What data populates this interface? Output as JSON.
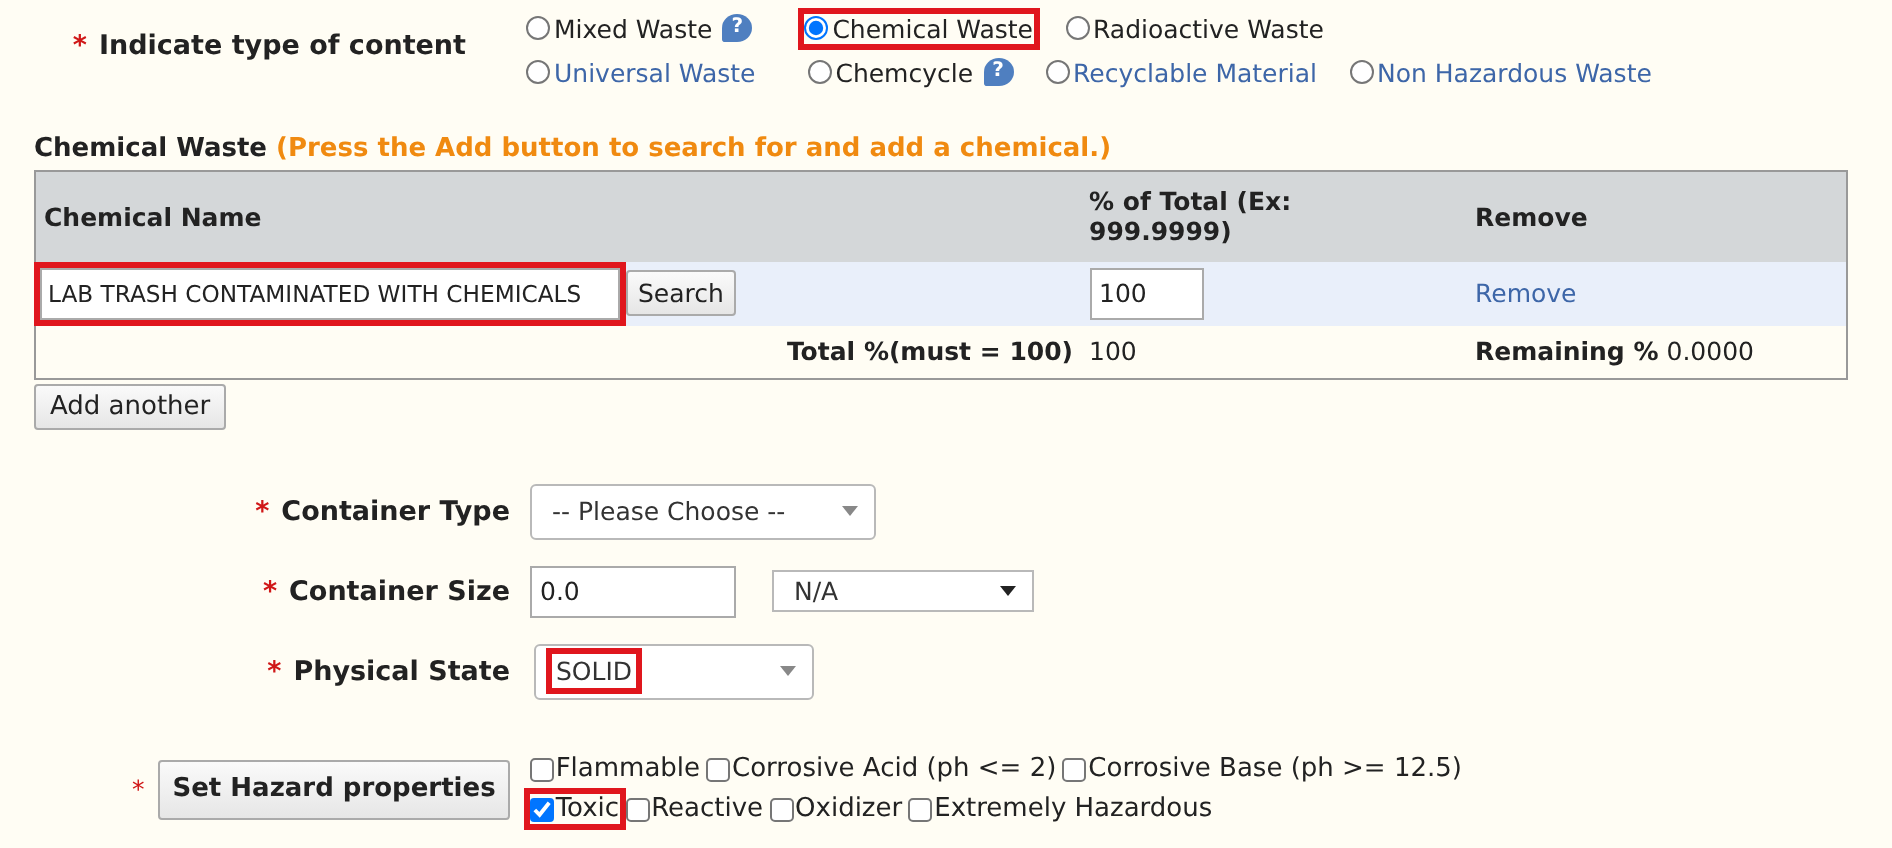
{
  "content_type": {
    "required_mark": "*",
    "label": "Indicate type of content",
    "option_rows": [
      {
        "options": [
          {
            "label": "Mixed Waste",
            "selected": false,
            "link": false,
            "highlighted": false,
            "help": "?"
          },
          {
            "label": "Chemical Waste",
            "selected": true,
            "link": false,
            "highlighted": true
          },
          {
            "label": "Radioactive Waste",
            "selected": false,
            "link": false,
            "highlighted": false
          }
        ]
      },
      {
        "options": [
          {
            "label": "Universal Waste",
            "selected": false,
            "link": true,
            "highlighted": false
          },
          {
            "label": "Chemcycle",
            "selected": false,
            "link": false,
            "highlighted": false,
            "help": "?"
          },
          {
            "label": "Recyclable Material",
            "selected": false,
            "link": true,
            "highlighted": false
          },
          {
            "label": "Non Hazardous Waste",
            "selected": false,
            "link": true,
            "highlighted": false
          }
        ]
      }
    ]
  },
  "chemical_section": {
    "title": "Chemical Waste",
    "hint": "(Press the Add button to search for and add a chemical.)",
    "columns": [
      "Chemical Name",
      "% of Total (Ex: 999.9999)",
      "Remove"
    ],
    "rows": [
      {
        "chemical_name": "LAB TRASH CONTAMINATED WITH CHEMICALS",
        "highlighted": true,
        "search_button": "Search",
        "percent": "100",
        "remove": "Remove"
      }
    ],
    "total": {
      "label": "Total %(must = 100)",
      "value": "100",
      "remaining": "**Remaining %** 0.0000"
    },
    "add_button": "Add another"
  },
  "container": {
    "fields": [
      {
        "kind": "select",
        "required_mark": "*",
        "label": "Container Type",
        "value": "-- Please Choose --",
        "highlighted": false
      },
      {
        "kind": "input_select",
        "required_mark": "*",
        "label": "Container Size",
        "value": "0.0",
        "unit": "N/A"
      },
      {
        "kind": "select",
        "required_mark": "*",
        "label": "Physical State",
        "value": "SOLID",
        "highlighted": true
      }
    ]
  },
  "hazard": {
    "required_mark": "*",
    "button": "Set Hazard properties",
    "option_rows": [
      {
        "options": [
          {
            "label": "Flammable",
            "checked": false,
            "highlighted": false
          },
          {
            "label": "Corrosive Acid (ph <= 2)",
            "checked": false,
            "highlighted": false
          },
          {
            "label": "Corrosive Base (ph >= 12.5)",
            "checked": false,
            "highlighted": false
          }
        ]
      },
      {
        "options": [
          {
            "label": "Toxic",
            "checked": true,
            "highlighted": true
          },
          {
            "label": "Reactive",
            "checked": false,
            "highlighted": false
          },
          {
            "label": "Oxidizer",
            "checked": false,
            "highlighted": false
          },
          {
            "label": "Extremely Hazardous",
            "checked": false,
            "highlighted": false
          }
        ]
      }
    ]
  }
}
